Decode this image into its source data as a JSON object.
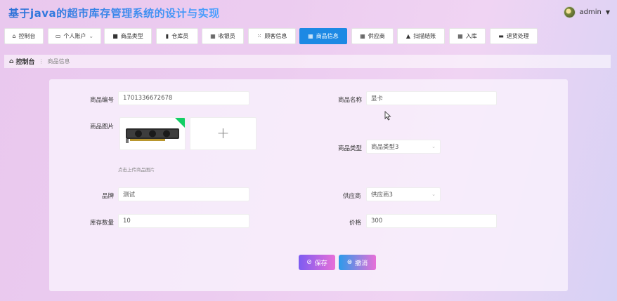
{
  "app": {
    "title": "基于java的超市库存管理系统的设计与实现",
    "user": "admin"
  },
  "nav": [
    {
      "label": "控制台",
      "icon": "home-icon"
    },
    {
      "label": "个人账户",
      "icon": "account-icon"
    },
    {
      "label": "商品类型",
      "icon": "tag-icon"
    },
    {
      "label": "仓库员",
      "icon": "chart-icon"
    },
    {
      "label": "收银员",
      "icon": "grid-icon"
    },
    {
      "label": "顾客信息",
      "icon": "apps-icon"
    },
    {
      "label": "商品信息",
      "icon": "grid-icon",
      "active": true
    },
    {
      "label": "供应商",
      "icon": "grid-icon"
    },
    {
      "label": "扫描结账",
      "icon": "bag-icon"
    },
    {
      "label": "入库",
      "icon": "grid-icon"
    },
    {
      "label": "退货处理",
      "icon": "message-icon"
    }
  ],
  "breadcrumb": {
    "home": "控制台",
    "current": "商品信息"
  },
  "form": {
    "code_label": "商品编号",
    "code_value": "1701336672678",
    "name_label": "商品名称",
    "name_value": "显卡",
    "image_label": "商品图片",
    "image_hint": "点击上传商品图片",
    "type_label": "商品类型",
    "type_value": "商品类型3",
    "brand_label": "品牌",
    "brand_value": "测试",
    "supplier_label": "供应商",
    "supplier_value": "供应商3",
    "stock_label": "库存数量",
    "stock_value": "10",
    "price_label": "价格",
    "price_value": "300"
  },
  "buttons": {
    "save": "保存",
    "cancel": "撤消"
  },
  "colors": {
    "accent": "#1d89e4",
    "title": "#2f7ad8",
    "badge": "#13ce66"
  }
}
